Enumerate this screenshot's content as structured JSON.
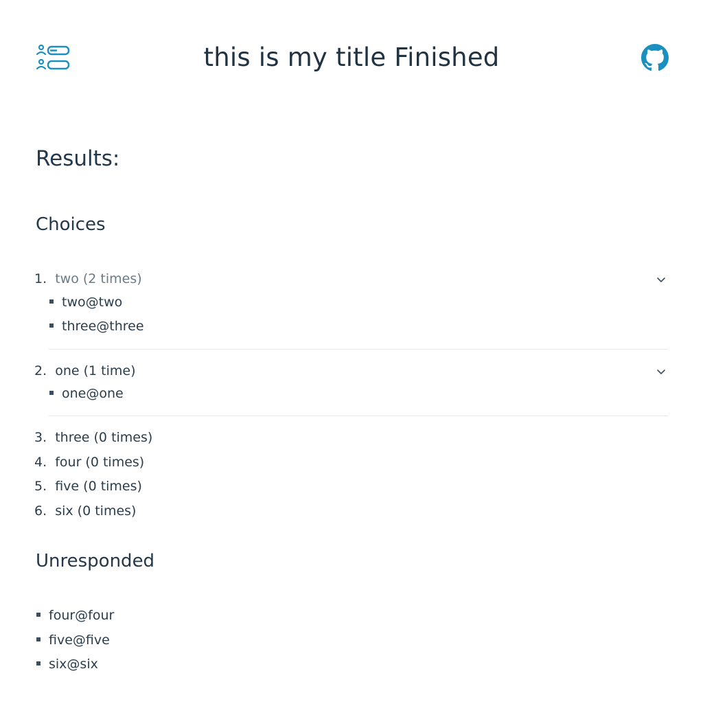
{
  "header": {
    "title": "this is my title Finished",
    "logo_icon": "list-users-icon",
    "github_icon": "github-icon",
    "accent": "#1b8fc0"
  },
  "results": {
    "heading": "Results:",
    "choices_heading": "Choices",
    "expanded": [
      {
        "num": "1.",
        "label": "two (2 times)",
        "members": [
          "two@two",
          "three@three"
        ]
      },
      {
        "num": "2.",
        "label": "one (1 time)",
        "members": [
          "one@one"
        ]
      }
    ],
    "rest": [
      {
        "num": "3.",
        "label": "three (0 times)"
      },
      {
        "num": "4.",
        "label": "four (0 times)"
      },
      {
        "num": "5.",
        "label": "five (0 times)"
      },
      {
        "num": "6.",
        "label": "six (0 times)"
      }
    ],
    "unresponded_heading": "Unresponded",
    "unresponded": [
      "four@four",
      "five@five",
      "six@six"
    ]
  }
}
